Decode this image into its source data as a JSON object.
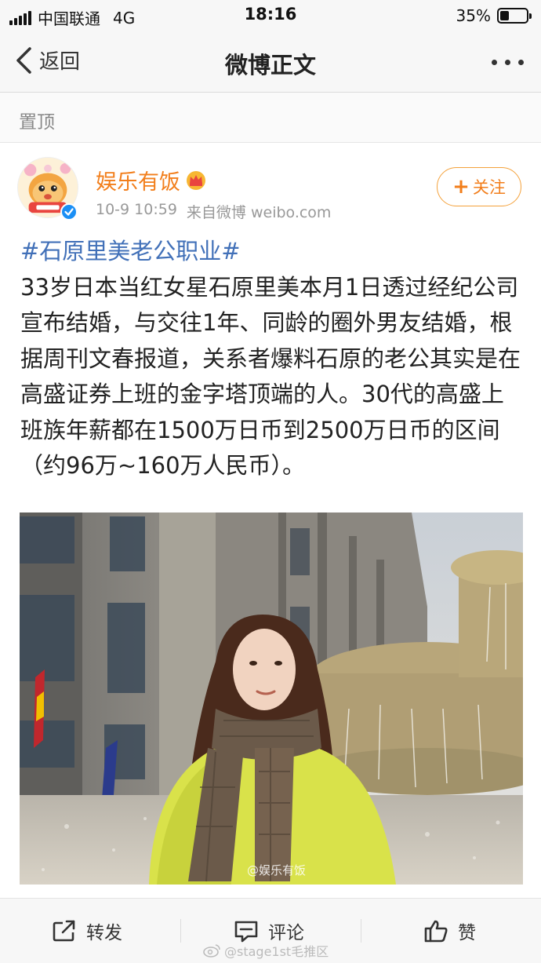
{
  "status_bar": {
    "carrier": "中国联通",
    "network": "4G",
    "time": "18:16",
    "battery": "35%",
    "battery_level": 0.35
  },
  "nav": {
    "back_label": "返回",
    "title": "微博正文"
  },
  "pinned_label": "置顶",
  "author": {
    "name": "娱乐有饭",
    "date": "10-9 10:59",
    "source": "来自微博 weibo.com",
    "follow_label": "关注"
  },
  "post": {
    "topic": "#石原里美老公职业#",
    "text": "33岁日本当红女星石原里美本月1日透过经纪公司宣布结婚，与交往1年、同龄的圈外男友结婚，根据周刊文春报道，关系者爆料石原的老公其实是在高盛证券上班的金字塔顶端的人。30代的高盛上班族年薪都在1500万日币到2500万日币的区间（约96万~160万人民币）。",
    "image_watermark": "@娱乐有饭"
  },
  "actions": {
    "repost": "转发",
    "comment": "评论",
    "like": "赞"
  },
  "bottom_watermark": "@stage1st毛推区",
  "colors": {
    "accent_orange": "#f27e1b",
    "topic_blue": "#4170b8",
    "verified_blue": "#1b8ff5"
  }
}
